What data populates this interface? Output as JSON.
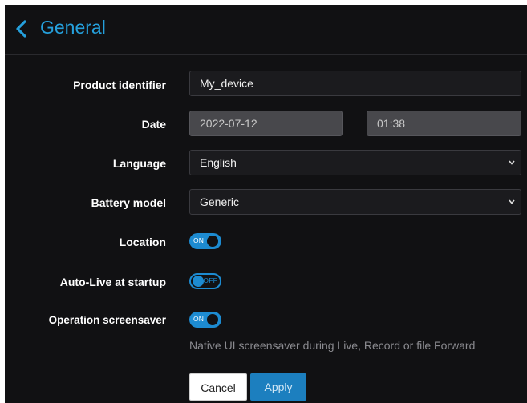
{
  "header": {
    "title": "General",
    "back_icon": "chevron-left-icon"
  },
  "form": {
    "product_identifier": {
      "label": "Product identifier",
      "value": "My_device"
    },
    "date": {
      "label": "Date",
      "date_value": "2022-07-12",
      "time_value": "01:38"
    },
    "language": {
      "label": "Language",
      "value": "English"
    },
    "battery_model": {
      "label": "Battery model",
      "value": "Generic"
    },
    "location": {
      "label": "Location",
      "state": "ON"
    },
    "auto_live": {
      "label": "Auto-Live at startup",
      "state": "OFF"
    },
    "screensaver": {
      "label": "Operation screensaver",
      "state": "ON",
      "hint": "Native UI screensaver during Live, Record or file Forward"
    }
  },
  "actions": {
    "cancel_label": "Cancel",
    "apply_label": "Apply"
  },
  "colors": {
    "accent": "#25a0dc",
    "background": "#111113",
    "toggle": "#1d8bd1"
  }
}
